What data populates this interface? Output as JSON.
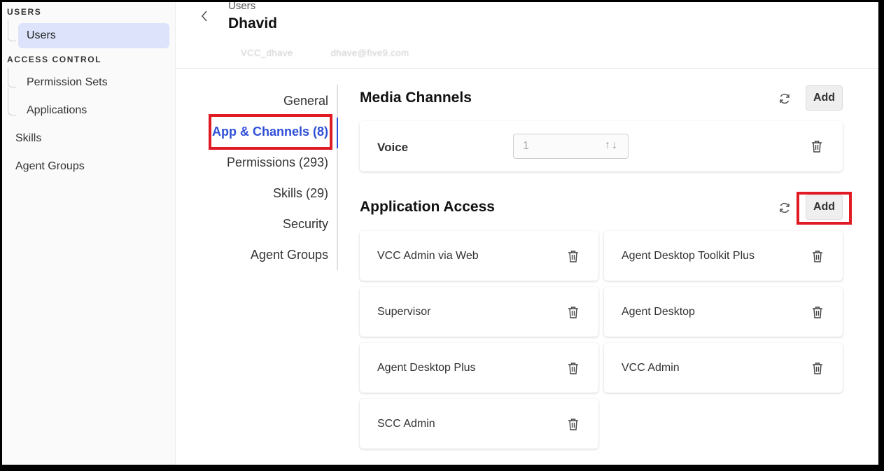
{
  "sidebar": {
    "users_section": "USERS",
    "users_item": "Users",
    "access_section": "ACCESS CONTROL",
    "permission_sets": "Permission Sets",
    "applications": "Applications",
    "skills": "Skills",
    "agent_groups": "Agent Groups"
  },
  "header": {
    "breadcrumb": "Users",
    "user_name": "Dhavid",
    "meta_id": "VCC_dhave",
    "meta_email": "dhave@five9.com"
  },
  "tabs": [
    {
      "label": "General"
    },
    {
      "label": "App & Channels (8)",
      "active": true
    },
    {
      "label": "Permissions (293)"
    },
    {
      "label": "Skills (29)"
    },
    {
      "label": "Security"
    },
    {
      "label": "Agent Groups"
    }
  ],
  "media_channels": {
    "title": "Media Channels",
    "add_label": "Add",
    "channels": [
      {
        "name": "Voice",
        "value": "1"
      }
    ]
  },
  "application_access": {
    "title": "Application Access",
    "add_label": "Add",
    "apps": [
      "VCC Admin via Web",
      "Agent Desktop Toolkit Plus",
      "Supervisor",
      "Agent Desktop",
      "Agent Desktop Plus",
      "VCC Admin",
      "SCC Admin"
    ]
  },
  "colors": {
    "accent": "#2f4fd8",
    "active_bg": "#dde3fb",
    "highlight": "#e01b24"
  },
  "icons": [
    "chevron-left-icon",
    "refresh-icon",
    "trash-icon",
    "arrow-up-icon",
    "arrow-down-icon"
  ]
}
